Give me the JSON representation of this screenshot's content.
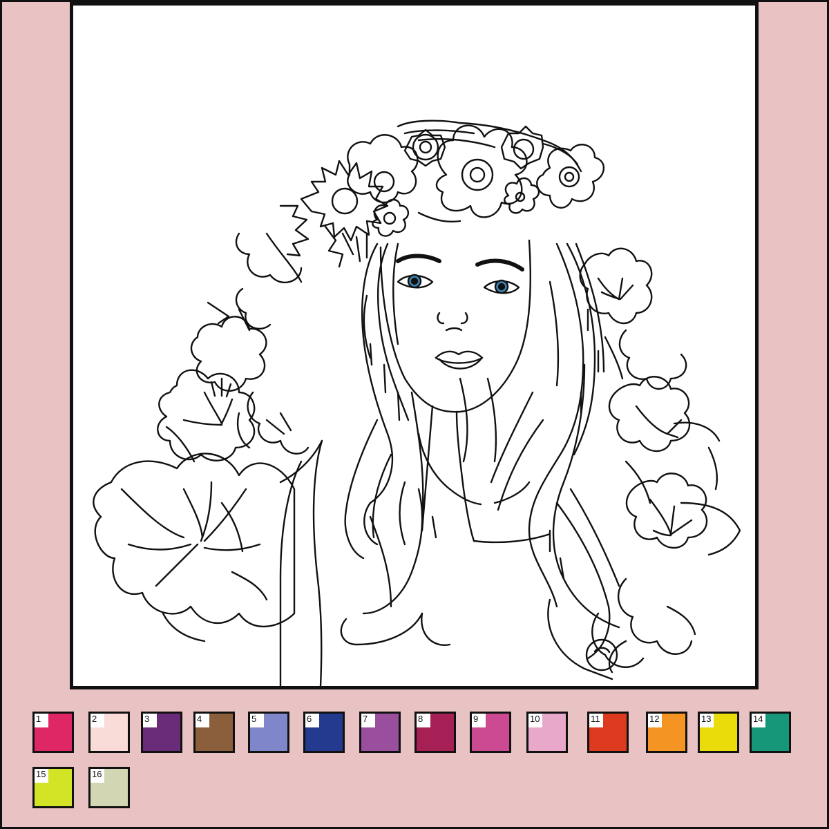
{
  "palette": [
    {
      "number": "1",
      "color": "#e02766"
    },
    {
      "number": "2",
      "color": "#f9dcd8"
    },
    {
      "number": "3",
      "color": "#6a2b78"
    },
    {
      "number": "4",
      "color": "#8b5e3c"
    },
    {
      "number": "5",
      "color": "#7f86c9"
    },
    {
      "number": "6",
      "color": "#233a8f"
    },
    {
      "number": "7",
      "color": "#9a4f9e"
    },
    {
      "number": "8",
      "color": "#a62056"
    },
    {
      "number": "9",
      "color": "#cb4a92"
    },
    {
      "number": "10",
      "color": "#e8a8c9"
    },
    {
      "number": "11",
      "color": "#dd3a20"
    },
    {
      "number": "12",
      "color": "#f39423"
    },
    {
      "number": "13",
      "color": "#eadb0b"
    },
    {
      "number": "14",
      "color": "#17977a"
    },
    {
      "number": "15",
      "color": "#d3e325"
    },
    {
      "number": "16",
      "color": "#d2d6b2"
    }
  ],
  "colors": {
    "background": "#e9c2c3",
    "canvas": "#ffffff",
    "outline": "#111111",
    "iris": "#3d86b8"
  },
  "artwork": {
    "subject": "girl-with-flower-crown-coloring-page"
  }
}
